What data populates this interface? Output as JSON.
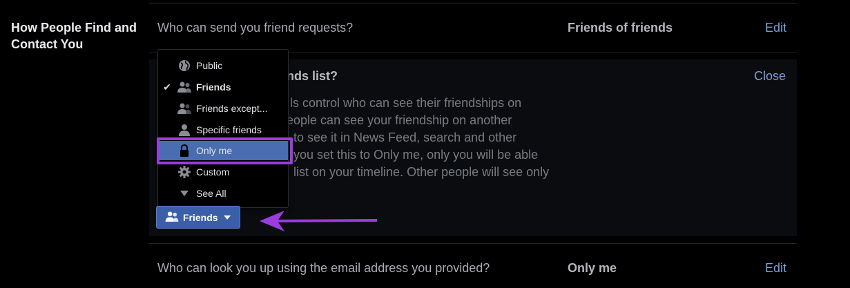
{
  "section": {
    "title": "How People Find and Contact You"
  },
  "rows": [
    {
      "question": "Who can send you friend requests?",
      "value": "Friends of friends",
      "action": "Edit"
    },
    {
      "question": "Who can look you up using the email address you provided?",
      "value": "Only me",
      "action": "Edit"
    }
  ],
  "panel": {
    "title_visible": "ends list?",
    "close": "Close",
    "description_lines": [
      "ls control who can see their friendships on",
      "people can see your friendship on another",
      "to see it in News Feed, search and other",
      "you set this to Only me, only you will be able",
      "list on your timeline. Other people will see only"
    ]
  },
  "dropdown": {
    "items": [
      {
        "label": "Public",
        "icon": "globe-icon",
        "checked": false,
        "selected": false
      },
      {
        "label": "Friends",
        "icon": "friends-icon",
        "checked": true,
        "selected": false
      },
      {
        "label": "Friends except...",
        "icon": "friends-except-icon",
        "checked": false,
        "selected": false
      },
      {
        "label": "Specific friends",
        "icon": "person-icon",
        "checked": false,
        "selected": false
      },
      {
        "label": "Only me",
        "icon": "lock-icon",
        "checked": false,
        "selected": true
      },
      {
        "label": "Custom",
        "icon": "gear-icon",
        "checked": false,
        "selected": false
      },
      {
        "label": "See All",
        "icon": "caret-down-icon",
        "checked": false,
        "selected": false
      }
    ]
  },
  "audience_button": {
    "label": "Friends"
  },
  "colors": {
    "link": "#7f9fdb",
    "button": "#3b5eaa",
    "highlight": "#9b3ce0",
    "arrow": "#9b3ce0",
    "selected": "#4a6db1"
  }
}
